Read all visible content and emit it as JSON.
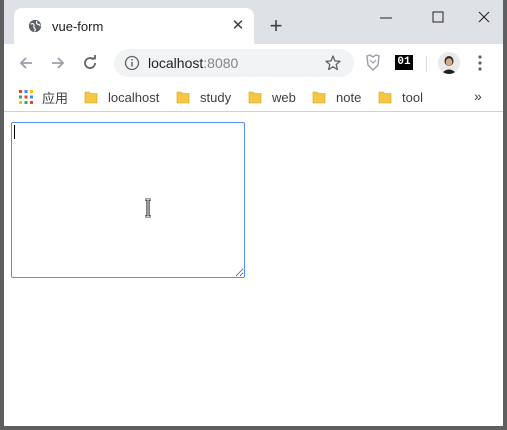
{
  "tab": {
    "title": "vue-form",
    "favicon": "globe-icon",
    "close_glyph": "✕"
  },
  "new_tab_glyph": "+",
  "window_controls": {
    "minimize": "—",
    "maximize": "☐",
    "close": "✕"
  },
  "toolbar": {
    "url_host": "localhost",
    "url_port": ":8080",
    "ext_badge": "01"
  },
  "bookmarks": {
    "apps_label": "应用",
    "items": [
      {
        "label": "localhost"
      },
      {
        "label": "study"
      },
      {
        "label": "web"
      },
      {
        "label": "note"
      },
      {
        "label": "tool"
      }
    ],
    "more_glyph": "»"
  },
  "colors": {
    "tabstrip": "#dee1e6",
    "focus_border": "#4d90fe",
    "folder": "#f6c744"
  },
  "form": {
    "textarea_value": ""
  }
}
